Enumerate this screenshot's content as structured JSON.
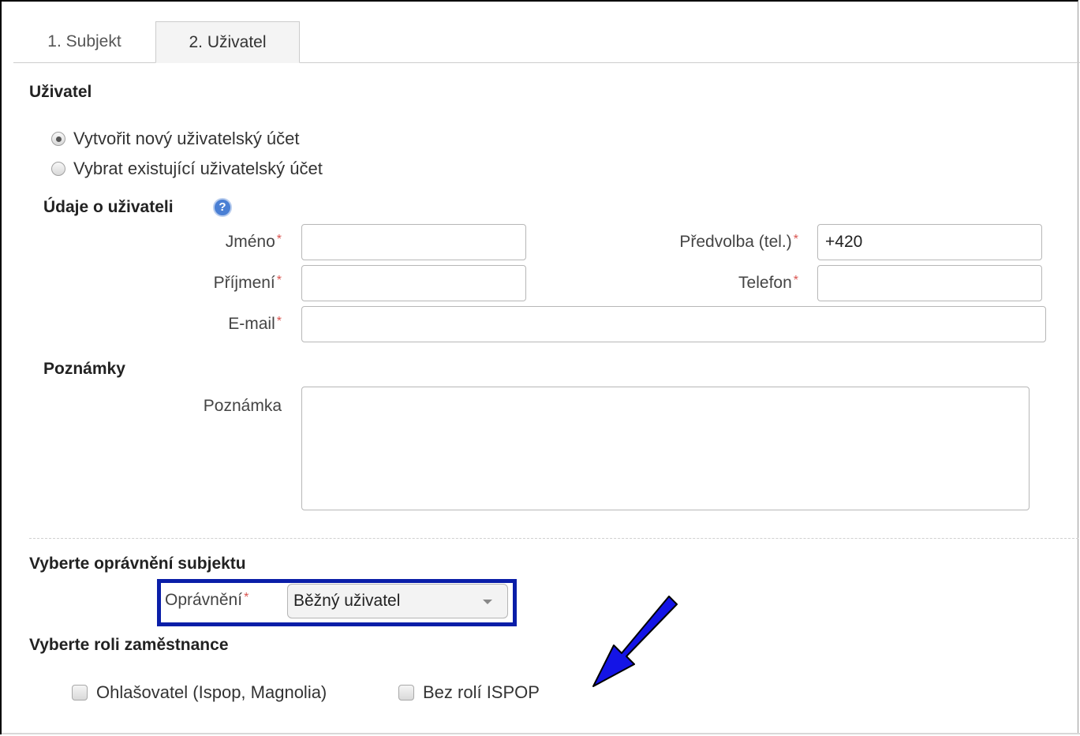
{
  "tabs": [
    {
      "label": "1. Subjekt"
    },
    {
      "label": "2. Uživatel"
    }
  ],
  "section_user": {
    "title": "Uživatel",
    "radio_options": [
      {
        "label": "Vytvořit nový uživatelský účet",
        "checked": true
      },
      {
        "label": "Vybrat existující uživatelský účet",
        "checked": false
      }
    ]
  },
  "user_details": {
    "title": "Údaje o uživateli",
    "help_icon": "?",
    "required_mark": "*",
    "fields": {
      "first_name": {
        "label": "Jméno",
        "value": ""
      },
      "last_name": {
        "label": "Příjmení",
        "value": ""
      },
      "email": {
        "label": "E-mail",
        "value": ""
      },
      "prefix": {
        "label": "Předvolba (tel.)",
        "value": "+420"
      },
      "phone": {
        "label": "Telefon",
        "value": ""
      }
    }
  },
  "notes": {
    "title": "Poznámky",
    "field_label": "Poznámka",
    "value": ""
  },
  "permissions": {
    "title": "Vyberte oprávnění subjektu",
    "field_label": "Oprávnění",
    "selected": "Běžný uživatel",
    "highlight_color": "#0a1ea8"
  },
  "roles": {
    "title": "Vyberte roli zaměstnance",
    "options": [
      {
        "label": "Ohlašovatel (Ispop, Magnolia)",
        "checked": false
      },
      {
        "label": "Bez rolí ISPOP",
        "checked": false
      }
    ]
  },
  "annotation": {
    "arrow_icon": "arrow-down-left",
    "arrow_color": "#1414e6"
  }
}
